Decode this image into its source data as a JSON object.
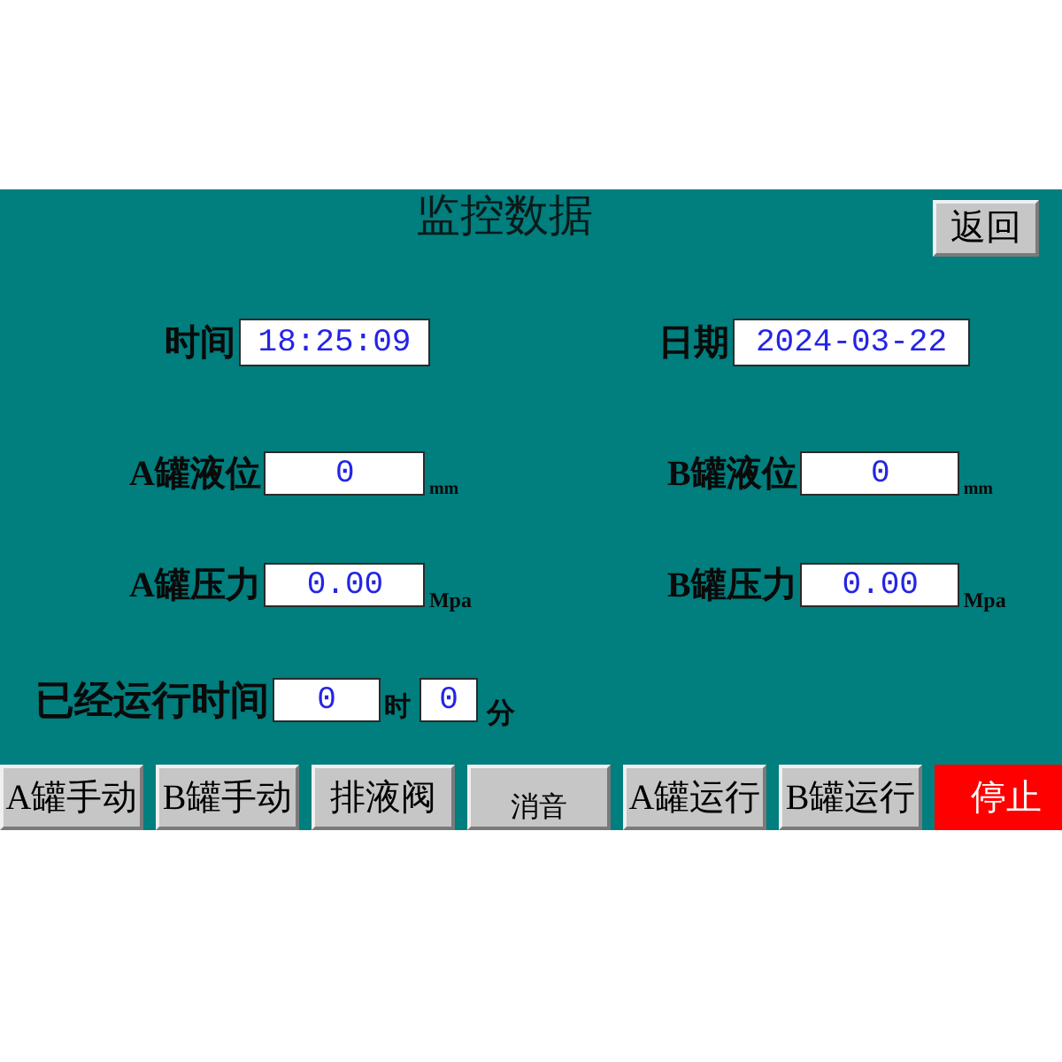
{
  "title": "监控数据",
  "back_button": "返回",
  "rows": [
    [
      {
        "label": "时间",
        "value": "18:25:09"
      },
      {
        "label": "日期",
        "value": "2024-03-22"
      }
    ],
    [
      {
        "label": "A罐液位",
        "value": "0",
        "unit": "mm"
      },
      {
        "label": "B罐液位",
        "value": "0",
        "unit": "mm"
      }
    ],
    [
      {
        "label": "A罐压力",
        "value": "0.00",
        "unit": "Mpa"
      },
      {
        "label": "B罐压力",
        "value": "0.00",
        "unit": "Mpa"
      }
    ]
  ],
  "runtime": {
    "label": "已经运行时间",
    "hours": "0",
    "hours_unit": "时",
    "minutes": "0",
    "minutes_unit": "分"
  },
  "buttons": [
    {
      "label": "A罐手动",
      "kind": "standard"
    },
    {
      "label": "B罐手动",
      "kind": "standard"
    },
    {
      "label": "排液阀",
      "kind": "standard"
    },
    {
      "label": "消音",
      "kind": "compact"
    },
    {
      "label": "A罐运行",
      "kind": "standard"
    },
    {
      "label": "B罐运行",
      "kind": "standard"
    },
    {
      "label": "停止",
      "kind": "stop"
    }
  ]
}
